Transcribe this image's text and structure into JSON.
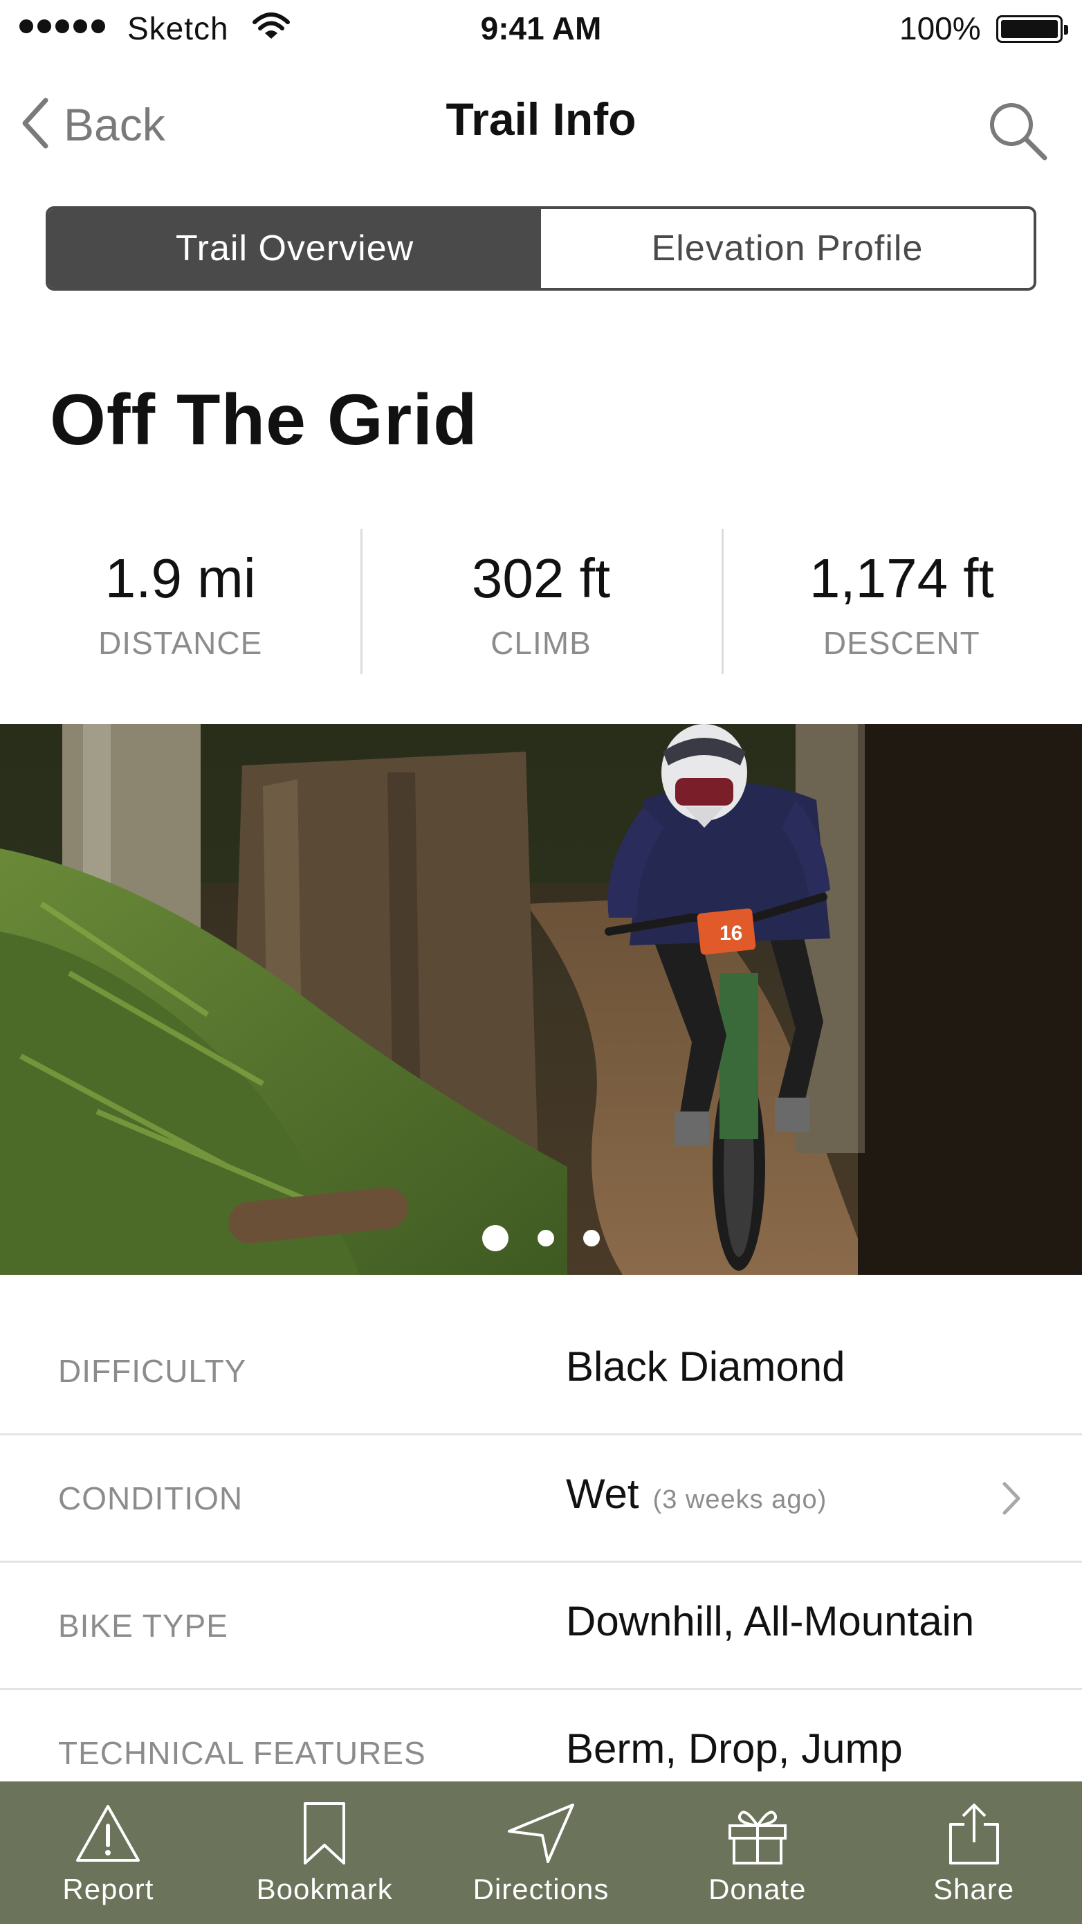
{
  "status_bar": {
    "carrier": "Sketch",
    "time": "9:41 AM",
    "battery": "100%"
  },
  "nav": {
    "back_label": "Back",
    "title": "Trail Info"
  },
  "segments": [
    {
      "label": "Trail Overview",
      "active": true
    },
    {
      "label": "Elevation Profile",
      "active": false
    }
  ],
  "trail": {
    "name": "Off The Grid"
  },
  "stats": [
    {
      "value": "1.9 mi",
      "label": "DISTANCE"
    },
    {
      "value": "302 ft",
      "label": "CLIMB"
    },
    {
      "value": "1,174 ft",
      "label": "DESCENT"
    }
  ],
  "carousel": {
    "page_count": 3,
    "current_page": 1,
    "bib_number": "16"
  },
  "details": [
    {
      "label": "DIFFICULTY",
      "value": "Black Diamond",
      "note": ""
    },
    {
      "label": "CONDITION",
      "value": "Wet",
      "note": "(3 weeks ago)"
    },
    {
      "label": "BIKE TYPE",
      "value": "Downhill, All-Mountain",
      "note": ""
    },
    {
      "label": "TECHNICAL FEATURES",
      "value": "Berm, Drop, Jump",
      "note": ""
    }
  ],
  "tab_bar": {
    "report": "Report",
    "bookmark": "Bookmark",
    "directions": "Directions",
    "donate": "Donate",
    "share": "Share"
  },
  "icons": [
    "signal-dots-icon",
    "wifi-icon",
    "battery-icon",
    "chevron-left-icon",
    "search-icon",
    "chevron-right-icon",
    "warning-icon",
    "bookmark-icon",
    "navigation-arrow-icon",
    "gift-icon",
    "share-icon"
  ],
  "colors": {
    "tab_bar_bg": "#6b735a",
    "segment_active_bg": "#4a4a4a",
    "label_gray": "#8c8c8c",
    "divider": "#e4e4e4"
  }
}
